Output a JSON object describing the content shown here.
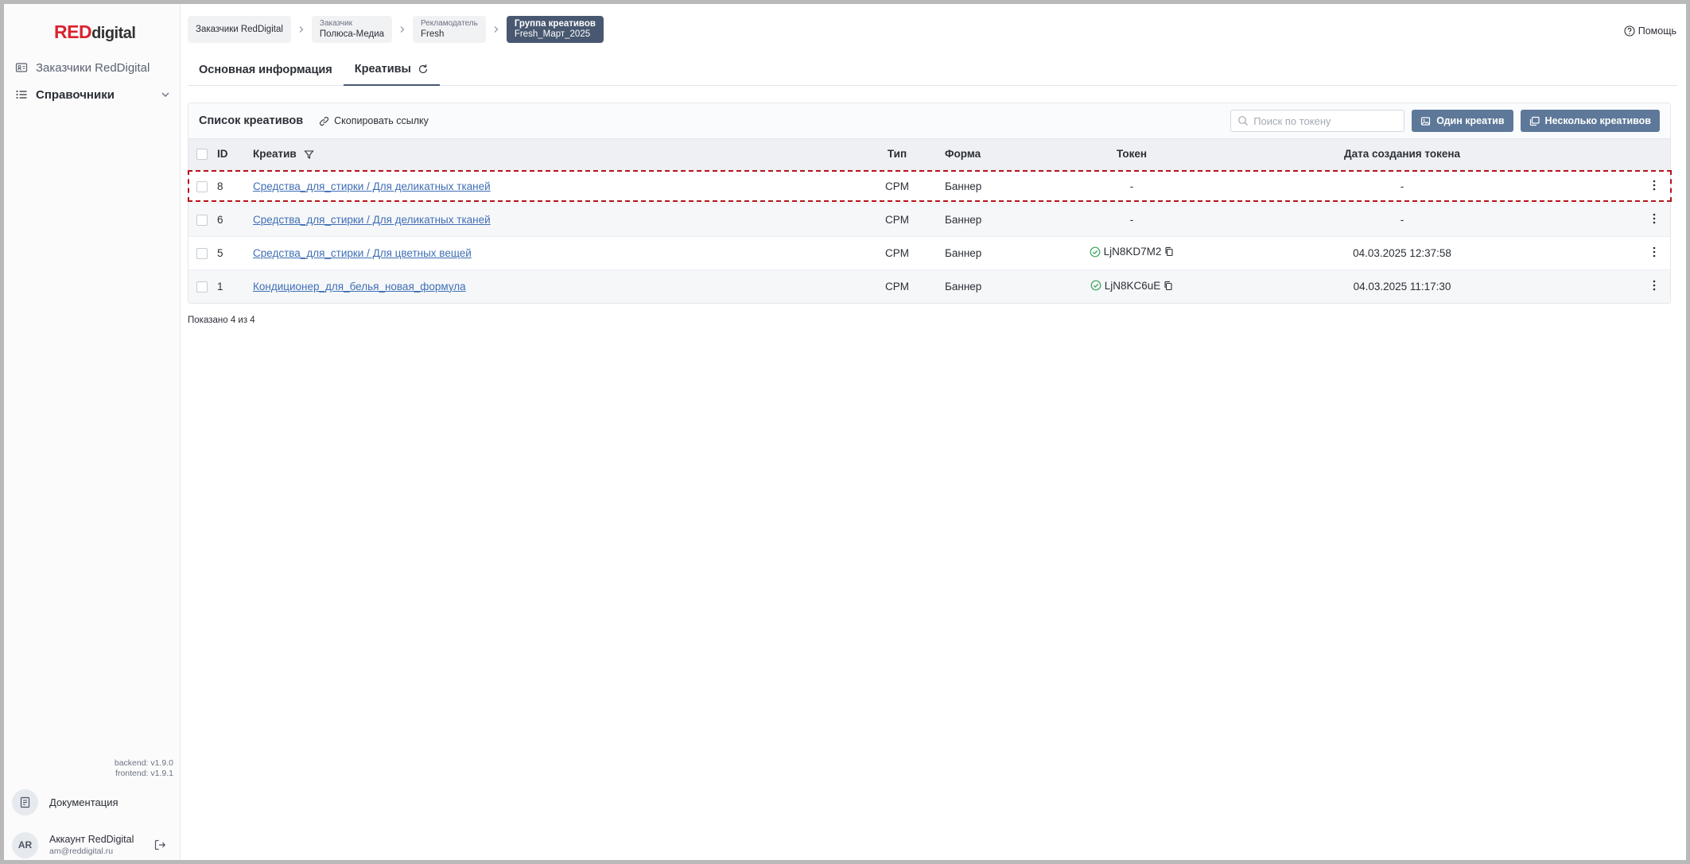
{
  "logo": {
    "red": "RED",
    "digital": "digital"
  },
  "sidebar": {
    "items": [
      {
        "label": "Заказчики RedDigital"
      },
      {
        "label": "Справочники"
      }
    ],
    "versions": {
      "backend": "backend: v1.9.0",
      "frontend": "frontend: v1.9.1"
    },
    "docs_label": "Документация",
    "account": {
      "initials": "AR",
      "name": "Аккаунт RedDigital",
      "email": "am@reddigital.ru"
    }
  },
  "breadcrumbs": [
    {
      "caption": "Заказчики RedDigital",
      "value": ""
    },
    {
      "caption": "Заказчик",
      "value": "Полюса-Медиа"
    },
    {
      "caption": "Рекламодатель",
      "value": "Fresh"
    },
    {
      "caption": "Группа креативов",
      "value": "Fresh_Март_2025"
    }
  ],
  "help_label": "Помощь",
  "tabs": [
    {
      "label": "Основная информация"
    },
    {
      "label": "Креативы"
    }
  ],
  "list": {
    "title": "Список креативов",
    "copy_link": "Скопировать ссылку",
    "search_placeholder": "Поиск по токену",
    "btn_one": "Один креатив",
    "btn_many": "Несколько креативов",
    "columns": {
      "id": "ID",
      "creative": "Креатив",
      "type": "Тип",
      "form": "Форма",
      "token": "Токен",
      "date": "Дата создания токена"
    },
    "rows": [
      {
        "id": "8",
        "name": "Средства_для_стирки / Для деликатных тканей",
        "type": "CPM",
        "form": "Баннер",
        "token": "-",
        "date": "-"
      },
      {
        "id": "6",
        "name": "Средства_для_стирки / Для деликатных тканей",
        "type": "CPM",
        "form": "Баннер",
        "token": "-",
        "date": "-"
      },
      {
        "id": "5",
        "name": "Средства_для_стирки / Для цветных вещей",
        "type": "CPM",
        "form": "Баннер",
        "token": "LjN8KD7M2",
        "date": "04.03.2025 12:37:58"
      },
      {
        "id": "1",
        "name": "Кондиционер_для_белья_новая_формула",
        "type": "CPM",
        "form": "Баннер",
        "token": "LjN8KC6uE",
        "date": "04.03.2025 11:17:30"
      }
    ],
    "shown": "Показано 4 из 4"
  },
  "colors": {
    "accent": "#485870",
    "button": "#5e7899",
    "link": "#3f6fb5",
    "brand_red": "#d9232e",
    "highlight": "#b3141c",
    "ok": "#3aa35b"
  }
}
